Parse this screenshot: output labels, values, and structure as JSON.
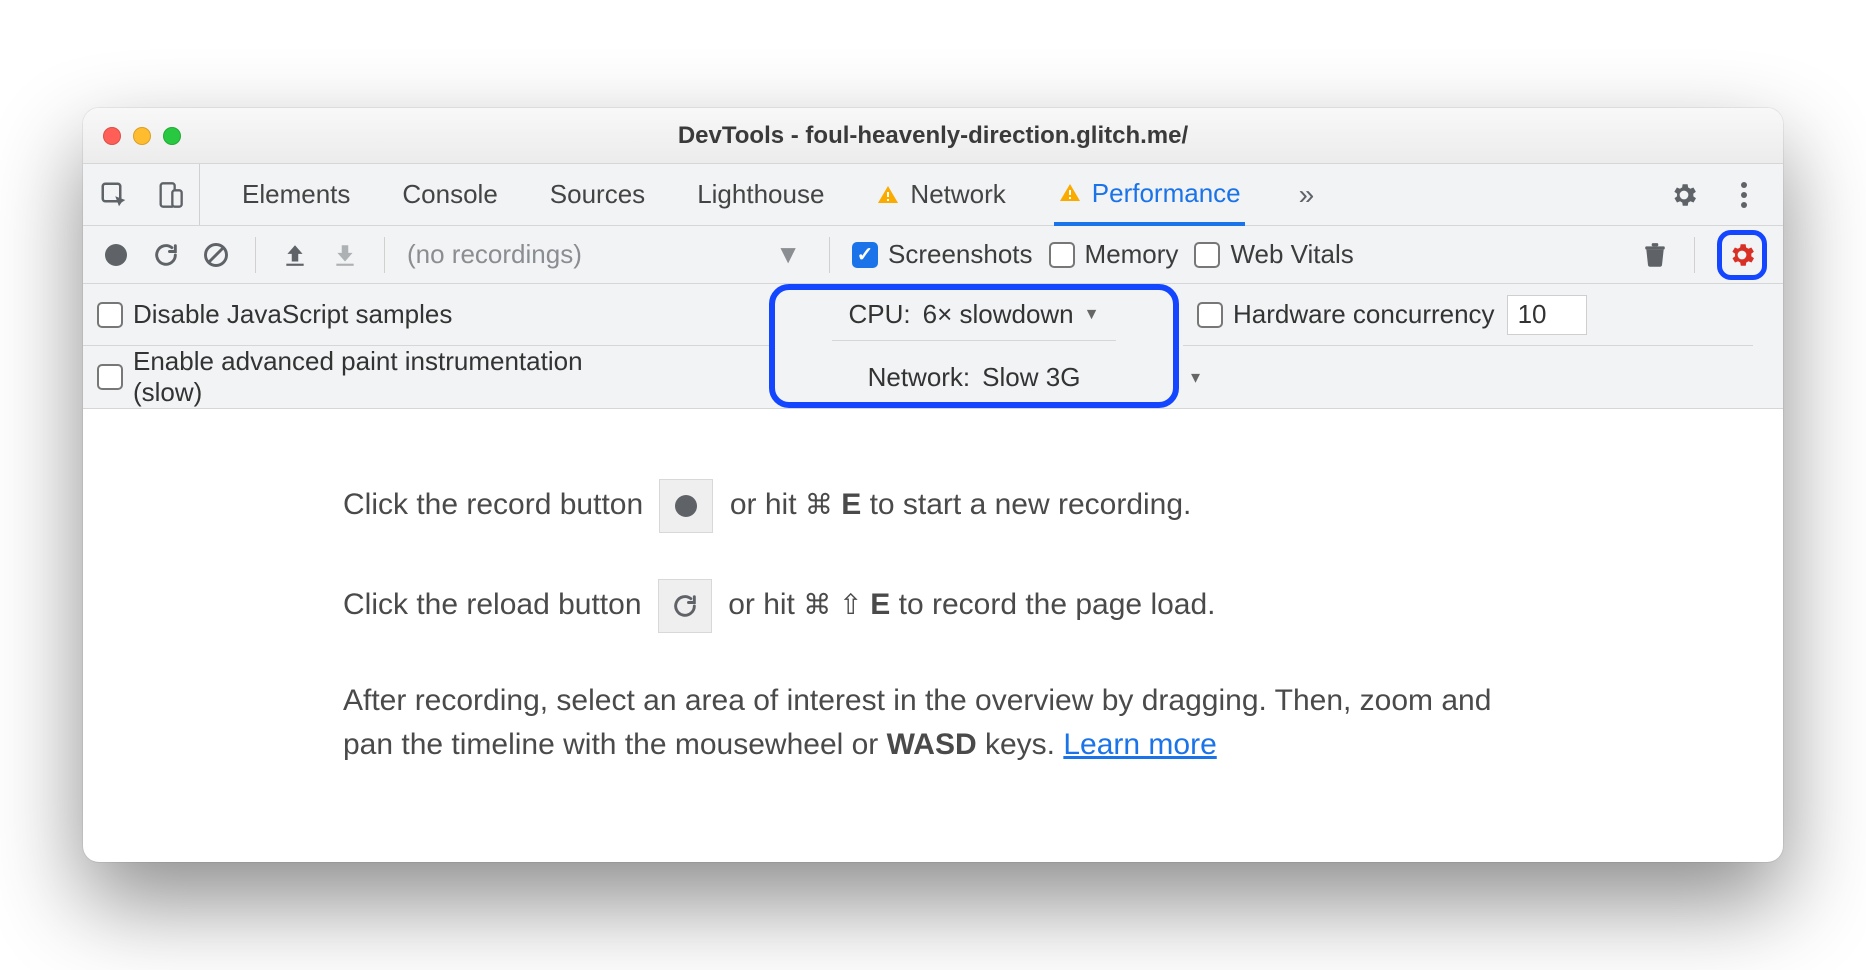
{
  "window": {
    "title": "DevTools - foul-heavenly-direction.glitch.me/"
  },
  "tabs": {
    "items": [
      "Elements",
      "Console",
      "Sources",
      "Lighthouse",
      "Network",
      "Performance"
    ],
    "active_index": 5,
    "warn_indices": [
      4,
      5
    ],
    "overflow_glyph": "»"
  },
  "toolbar": {
    "no_recordings": "(no recordings)",
    "screenshots": {
      "label": "Screenshots",
      "checked": true
    },
    "memory": {
      "label": "Memory",
      "checked": false
    },
    "webvitals": {
      "label": "Web Vitals",
      "checked": false
    }
  },
  "settings": {
    "disable_js": {
      "label": "Disable JavaScript samples",
      "checked": false
    },
    "adv_paint": {
      "label": "Enable advanced paint instrumentation (slow)",
      "checked": false
    },
    "cpu": {
      "label": "CPU:",
      "value": "6× slowdown"
    },
    "network": {
      "label": "Network:",
      "value": "Slow 3G"
    },
    "hw_conc": {
      "label": "Hardware concurrency",
      "checked": false,
      "value": "10"
    }
  },
  "hints": {
    "line1a": "Click the record button ",
    "line1b": " or hit ",
    "line1_shortcut_cmd": "⌘",
    "line1_shortcut_key": "E",
    "line1c": " to start a new recording.",
    "line2a": "Click the reload button ",
    "line2b": " or hit ",
    "line2_shortcut": "⌘ ⇧ ",
    "line2_shortcut_key": "E",
    "line2c": " to record the page load.",
    "line3a": "After recording, select an area of interest in the overview by dragging. Then, zoom and pan the timeline with the mousewheel or ",
    "line3_keys": "WASD",
    "line3b": " keys. ",
    "learn_more": "Learn more"
  }
}
